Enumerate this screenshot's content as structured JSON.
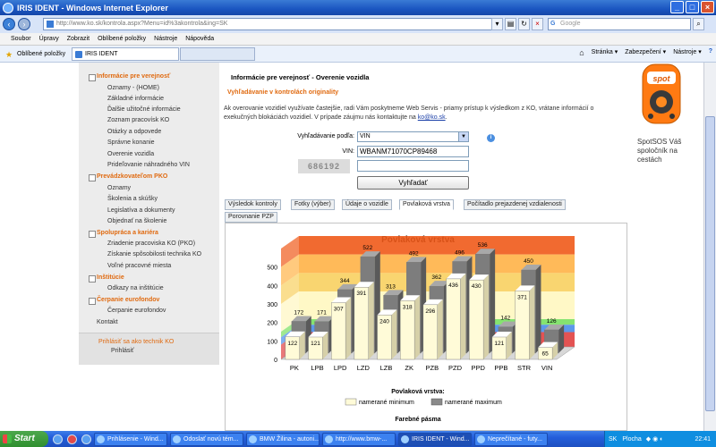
{
  "window": {
    "title": "IRIS IDENT - Windows Internet Explorer"
  },
  "address": {
    "url": "http://www.ko.sk/kontrola.aspx?Menu=id%3akontrola&ing=SK",
    "search_placeholder": "Google"
  },
  "menubar": [
    "Soubor",
    "Úpravy",
    "Zobrazit",
    "Oblíbené položky",
    "Nástroje",
    "Nápověda"
  ],
  "favbar": {
    "favorites": "Oblíbené položky",
    "tab_title": "IRIS IDENT",
    "cmd": [
      "Stránka ▾",
      "Zabezpečení ▾",
      "Nástroje ▾"
    ]
  },
  "left_menu": {
    "s1": "Informácie pre verejnosť",
    "s1_items": [
      "Oznamy - (HOME)",
      "Základné informácie",
      "Ďalšie užitočné informácie",
      "Zoznam pracovísk KO",
      "Otázky a odpovede",
      "Správne konanie",
      "Overenie vozidla",
      "Prideľovanie náhradného VIN"
    ],
    "s2": "Prevádzkovateľom PKO",
    "s2_items": [
      "Oznamy",
      "Školenia a skúšky",
      "Legislatíva a dokumenty",
      "Objednať na školenie"
    ],
    "s3": "Spolupráca a kariéra",
    "s3_items": [
      "Zriadenie pracoviska KO (PKO)",
      "Získanie spôsobilosti technika KO",
      "Voľné pracovné miesta"
    ],
    "s4": "Inštitúcie",
    "s4_items": [
      "Odkazy na inštitúcie"
    ],
    "s5": "Čerpanie eurofondov",
    "s5_items": [
      "Čerpanie eurofondov"
    ],
    "kontakt": "Kontakt",
    "login": "Prihlásiť sa ako technik KO",
    "login2": "Prihlásiť"
  },
  "main": {
    "heading": "Informácie pre verejnosť - Overenie vozidla",
    "subheading": "Vyhľadávanie v kontrolách originality",
    "desc": "Ak overovanie vozidiel využívate častejšie, radi Vám poskytneme Web Servis - priamy prístup k výsledkom z KO, vrátane informácií o exekučných blokáciách vozidiel. V prípade záujmu nás kontaktujte na",
    "email": "ko@ko.sk",
    "desc_end": ".",
    "label_search": "Vyhľadávanie podľa:",
    "search_value": "VIN",
    "label_vin": "VIN:",
    "vin_value": "WBANM71070CP89468",
    "captcha": "686192",
    "button": "Vyhľadať"
  },
  "tabs": [
    "Výsledok kontroly",
    "Fotky (výber)",
    "Údaje o vozidle",
    "Povlaková vrstva",
    "Počítadlo prejazdenej vzdialenosti",
    "Porovnanie PZP"
  ],
  "chart_data": {
    "type": "bar",
    "title": "Povlaková vrstva",
    "categories": [
      "PK",
      "LPB",
      "LPD",
      "LZD",
      "LZB",
      "ZK",
      "PZB",
      "PZD",
      "PPD",
      "PPB",
      "STR",
      "VIN"
    ],
    "series": [
      {
        "name": "namerané minimum",
        "values": [
          122,
          121,
          307,
          391,
          240,
          318,
          296,
          436,
          430,
          121,
          371,
          65
        ]
      },
      {
        "name": "namerané maximum",
        "values": [
          172,
          171,
          344,
          522,
          313,
          492,
          362,
          496,
          536,
          142,
          450,
          126
        ]
      }
    ],
    "yticks": [
      0,
      100,
      200,
      300,
      400,
      500
    ],
    "ylim": [
      0,
      600
    ],
    "legend_title": "Povlaková vrstva:",
    "bands_title": "Farebné pásma",
    "colors": {
      "min": "#fffbd8",
      "max": "#8a8a8a"
    }
  },
  "ad": {
    "text": "SpotSOS Váš spoločník na cestách"
  },
  "taskbar": {
    "start": "Start",
    "items": [
      "Prihlásenie - Wind...",
      "Odoslať novú tém...",
      "BMW Žilina - autoni...",
      "http://www.bmw-...",
      "IRIS IDENT - Wind...",
      "Neprečítané - futy..."
    ],
    "lang": "SK",
    "desktop": "Plocha",
    "clock": "22:41"
  }
}
